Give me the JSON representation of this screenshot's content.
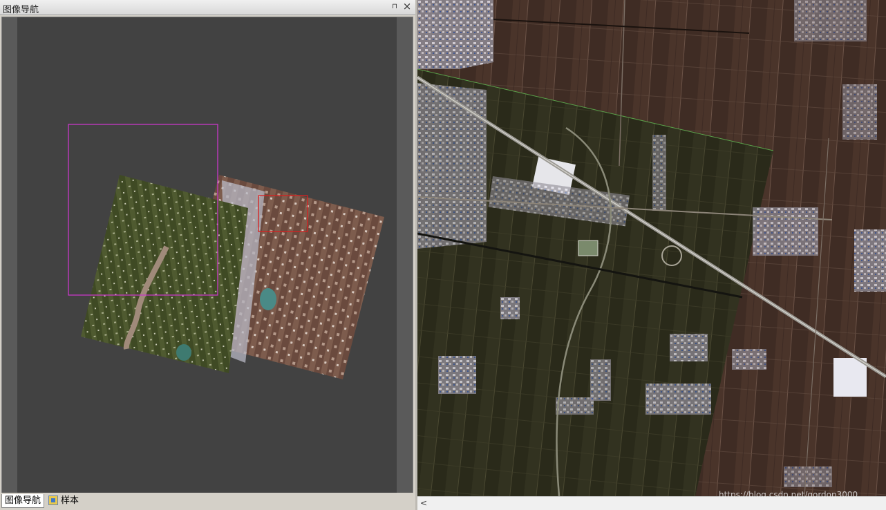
{
  "navigator": {
    "title": "图像导航",
    "pin_glyph": "⊓",
    "close_glyph": "×",
    "tabs": [
      {
        "label": "图像导航",
        "active": true
      },
      {
        "label": "样本",
        "active": false
      }
    ],
    "view_box_color": "#c838c8",
    "current_area_color": "#d82020"
  },
  "main_view": {
    "scroll_left_glyph": "<"
  },
  "watermark": "https://blog.csdn.net/gordon3000",
  "colors": {
    "panel_background": "#424242",
    "panel_chrome": "#d4d0c8",
    "farmland_old": "#3f2c24",
    "farmland_new": "#2a2a1a"
  }
}
